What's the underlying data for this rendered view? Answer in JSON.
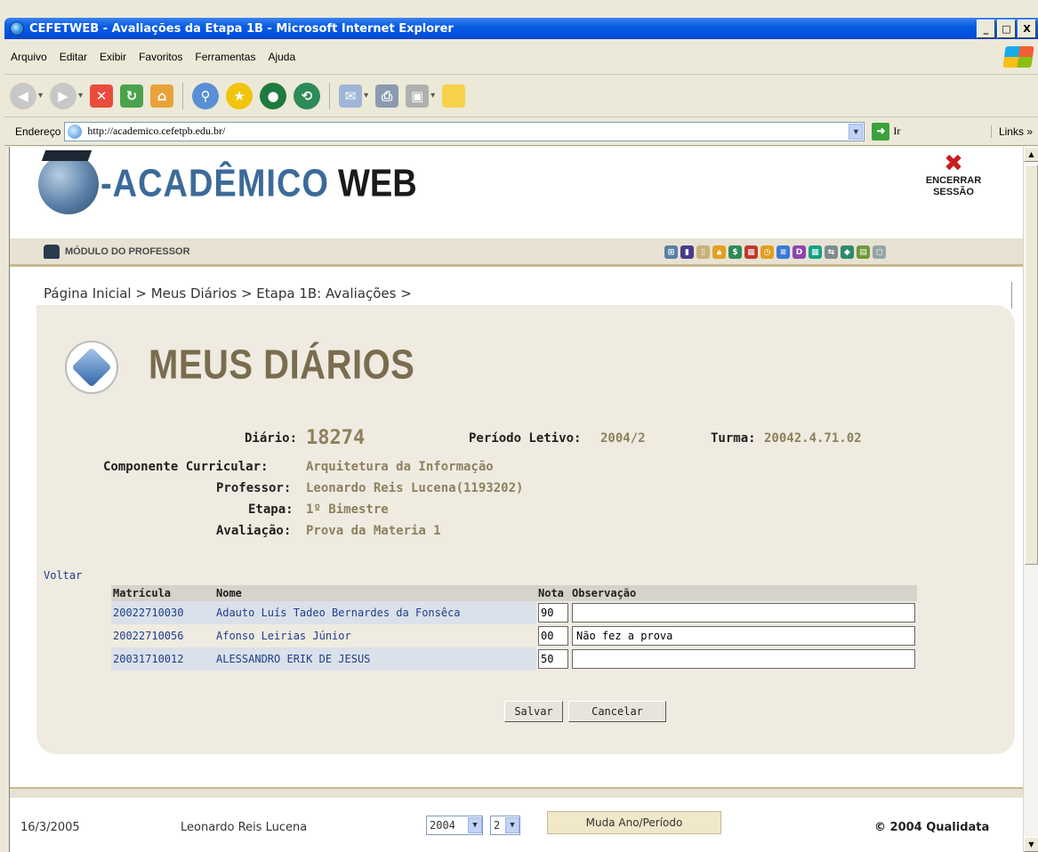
{
  "window": {
    "title": "CEFETWEB - Avaliações da Etapa 1B - Microsoft Internet Explorer",
    "controls": [
      "_",
      "□",
      "X"
    ]
  },
  "menu": [
    "Arquivo",
    "Editar",
    "Exibir",
    "Favoritos",
    "Ferramentas",
    "Ajuda"
  ],
  "address": {
    "label": "Endereço",
    "url": "http://academico.cefetpb.edu.br/",
    "go": "Ir",
    "links": "Links"
  },
  "header": {
    "logo_part1": "-ACADÊMICO",
    "logo_part2": "WEB",
    "logout_line1": "ENCERRAR",
    "logout_line2": "SESSÃO",
    "module": "MÓDULO DO PROFESSOR"
  },
  "breadcrumb": "Página Inicial > Meus Diários > Etapa 1B: Avaliações >",
  "section_title": "MEUS DIÁRIOS",
  "info": {
    "diario_label": "Diário:",
    "diario_value": "18274",
    "periodo_label": "Período Letivo:",
    "periodo_value": "2004/2",
    "turma_label": "Turma:",
    "turma_value": "20042.4.71.02",
    "componente_label": "Componente Curricular:",
    "componente_value": "Arquitetura da Informação",
    "professor_label": "Professor:",
    "professor_value": "Leonardo Reis Lucena(1193202)",
    "etapa_label": "Etapa:",
    "etapa_value": "1º Bimestre",
    "avaliacao_label": "Avaliação:",
    "avaliacao_value": "Prova da Materia 1"
  },
  "voltar": "Voltar",
  "table": {
    "headers": [
      "Matrícula",
      "Nome",
      "Nota",
      "Observação"
    ],
    "rows": [
      {
        "matricula": "20022710030",
        "nome": "Adauto Luís Tadeo Bernardes da Fonsêca",
        "nota": "90",
        "obs": ""
      },
      {
        "matricula": "20022710056",
        "nome": "Afonso Leirias Júnior",
        "nota": "00",
        "obs": "Não fez a prova"
      },
      {
        "matricula": "20031710012",
        "nome": "ALESSANDRO ERIK DE JESUS",
        "nota": "50",
        "obs": ""
      }
    ]
  },
  "buttons": {
    "save": "Salvar",
    "cancel": "Cancelar"
  },
  "footer": {
    "date": "16/3/2005",
    "user": "Leonardo Reis Lucena",
    "year": "2004",
    "period": "2",
    "change": "Muda Ano/Período",
    "copyright": "© 2004 Qualidata"
  },
  "colors": {
    "title_bar": "#0054e3",
    "accent_gold": "#8e805c",
    "link_blue": "#1d3f8c",
    "panel": "#efebe1"
  }
}
